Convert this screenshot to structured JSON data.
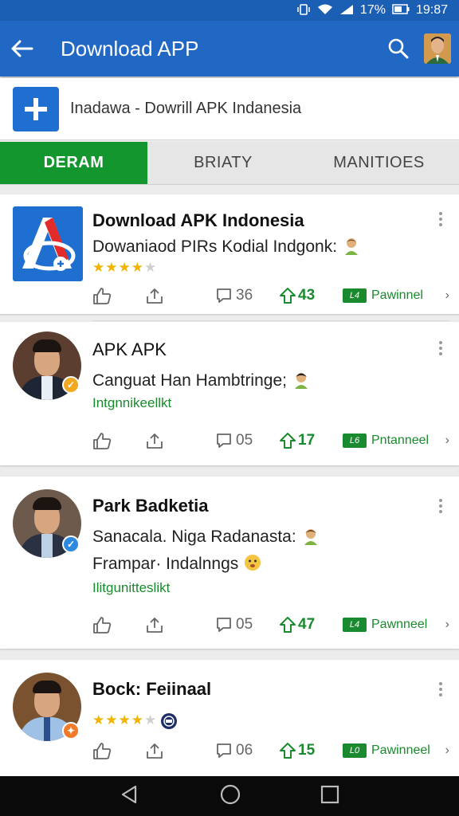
{
  "status_bar": {
    "battery": "17%",
    "time": "19:87"
  },
  "app_bar": {
    "title": "Download APP"
  },
  "banner": {
    "text": "Inadawa - Dowrill APK Indanesia"
  },
  "tabs": [
    {
      "label": "DERAM",
      "active": true
    },
    {
      "label": "BRIATY",
      "active": false
    },
    {
      "label": "MANITIOES",
      "active": false
    }
  ],
  "posts": [
    {
      "name": "Download APK Indonesia",
      "lines": [
        "Dowaniaod PIRs Kodial Indgonk:"
      ],
      "rating": 4,
      "comments": "36",
      "upvotes": "43",
      "download_badge": "L4",
      "download_label": "Pawinnel"
    },
    {
      "name": "APK APK",
      "lines": [
        "Canguat Han Hambtringe;"
      ],
      "green": "Intgnnikeellkt",
      "comments": "05",
      "upvotes": "17",
      "download_badge": "L6",
      "download_label": "Pntanneel"
    },
    {
      "name": "Park Badketia",
      "lines": [
        "Sanacala. Niga Radanasta:",
        "Frampar· Indalnngs"
      ],
      "green": "Ilitgunitteslikt",
      "comments": "05",
      "upvotes": "47",
      "download_badge": "L4",
      "download_label": "Pawnneel"
    },
    {
      "name": "Bock: Feiinaal",
      "rating": 4,
      "comments": "06",
      "upvotes": "15",
      "download_badge": "L0",
      "download_label": "Pawinneel"
    }
  ],
  "colors": {
    "primary": "#2068c4",
    "accent_green": "#14962e",
    "star": "#f2b400"
  },
  "icons": [
    "back-arrow-icon",
    "search-icon",
    "plus-icon",
    "like-icon",
    "share-icon",
    "comment-icon",
    "upvote-icon",
    "download-icon",
    "more-vert-icon",
    "nav-back-icon",
    "nav-home-icon",
    "nav-recents-icon"
  ]
}
